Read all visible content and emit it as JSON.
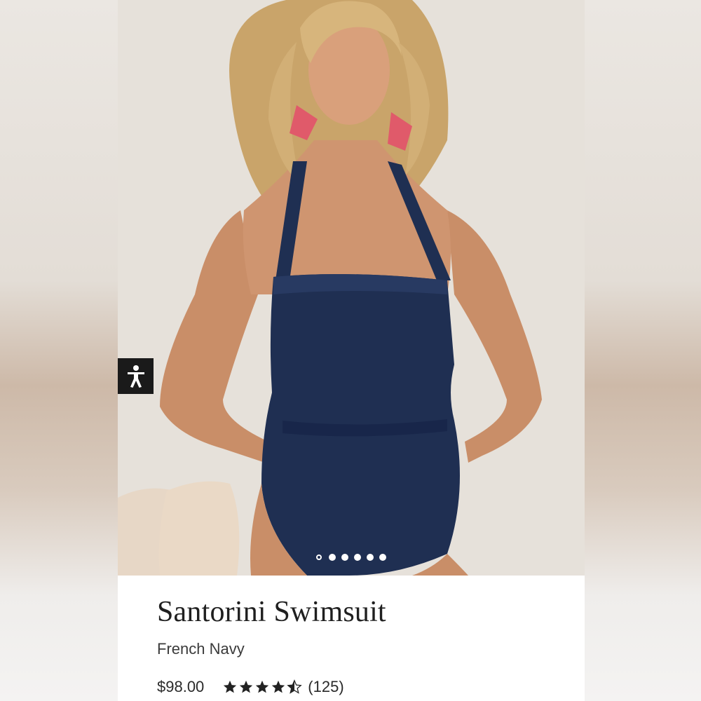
{
  "product": {
    "title": "Santorini Swimsuit",
    "color_name": "French Navy",
    "price": "$98.00",
    "rating": 4.5,
    "rating_max": 5,
    "review_count": "(125)"
  },
  "carousel": {
    "slide_count": 6,
    "active_index": 0
  },
  "accessibility_button": {
    "icon": "accessibility-person-icon"
  },
  "colors": {
    "swimsuit_navy": "#1f2f52",
    "card_background": "#ffffff",
    "text_dark": "#1f1f1f",
    "a11y_button": "#1a1a1a"
  }
}
